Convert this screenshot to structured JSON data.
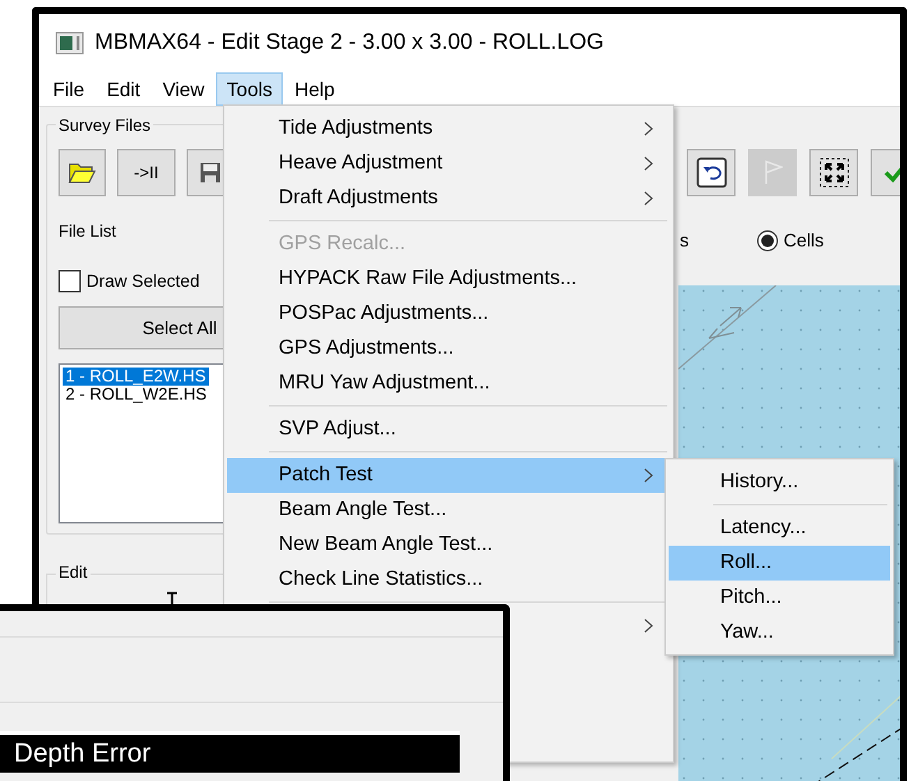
{
  "window": {
    "title": "MBMAX64 - Edit Stage 2 - 3.00 x 3.00 - ROLL.LOG"
  },
  "menu_bar": [
    {
      "label": "File",
      "selected": false
    },
    {
      "label": "Edit",
      "selected": false
    },
    {
      "label": "View",
      "selected": false
    },
    {
      "label": "Tools",
      "selected": true
    },
    {
      "label": "Help",
      "selected": false
    }
  ],
  "survey_files": {
    "title": "Survey Files",
    "buttons": [
      {
        "kind": "folder"
      },
      {
        "kind": "text",
        "label": "->II"
      },
      {
        "kind": "save"
      }
    ],
    "file_list_label": "File List",
    "draw_selected": {
      "label": "Draw Selected",
      "checked": false
    },
    "select_all": "Select All",
    "files": [
      {
        "label": "1 - ROLL_E2W.HS",
        "selected": true
      },
      {
        "label": "2 - ROLL_W2E.HS",
        "selected": false
      }
    ]
  },
  "edit": {
    "title": "Edit"
  },
  "toolbar": [
    {
      "kind": "undo",
      "disabled": false
    },
    {
      "kind": "flag",
      "disabled": true
    },
    {
      "kind": "fit",
      "disabled": false
    },
    {
      "kind": "check",
      "disabled": false
    }
  ],
  "view_option": {
    "partial_label": "s",
    "radio": {
      "label": "Cells",
      "selected": true
    }
  },
  "tools_menu": {
    "items": [
      {
        "kind": "item",
        "label": "Tide Adjustments",
        "submenu": true,
        "disabled": false,
        "selected": false
      },
      {
        "kind": "item",
        "label": "Heave Adjustment",
        "submenu": true,
        "disabled": false,
        "selected": false
      },
      {
        "kind": "item",
        "label": "Draft Adjustments",
        "submenu": true,
        "disabled": false,
        "selected": false
      },
      {
        "kind": "separator"
      },
      {
        "kind": "item",
        "label": "GPS Recalc...",
        "submenu": false,
        "disabled": true,
        "selected": false
      },
      {
        "kind": "item",
        "label": "HYPACK Raw File Adjustments...",
        "submenu": false,
        "disabled": false,
        "selected": false
      },
      {
        "kind": "item",
        "label": "POSPac Adjustments...",
        "submenu": false,
        "disabled": false,
        "selected": false
      },
      {
        "kind": "item",
        "label": "GPS Adjustments...",
        "submenu": false,
        "disabled": false,
        "selected": false
      },
      {
        "kind": "item",
        "label": "MRU Yaw Adjustment...",
        "submenu": false,
        "disabled": false,
        "selected": false
      },
      {
        "kind": "separator"
      },
      {
        "kind": "item",
        "label": "SVP Adjust...",
        "submenu": false,
        "disabled": false,
        "selected": false
      },
      {
        "kind": "separator"
      },
      {
        "kind": "item",
        "label": "Patch Test",
        "submenu": true,
        "disabled": false,
        "selected": true
      },
      {
        "kind": "item",
        "label": "Beam Angle Test...",
        "submenu": false,
        "disabled": false,
        "selected": false
      },
      {
        "kind": "item",
        "label": "New Beam Angle Test...",
        "submenu": false,
        "disabled": false,
        "selected": false
      },
      {
        "kind": "item",
        "label": "Check Line Statistics...",
        "submenu": false,
        "disabled": false,
        "selected": false
      },
      {
        "kind": "separator"
      },
      {
        "kind": "item",
        "submenu": true,
        "disabled": false,
        "selected": false
      }
    ]
  },
  "patch_test_submenu": {
    "items": [
      {
        "kind": "item",
        "label": "History...",
        "selected": false
      },
      {
        "kind": "separator"
      },
      {
        "kind": "item",
        "label": "Latency...",
        "selected": false
      },
      {
        "kind": "item",
        "label": "Roll...",
        "selected": true
      },
      {
        "kind": "item",
        "label": "Pitch...",
        "selected": false
      },
      {
        "kind": "item",
        "label": "Yaw...",
        "selected": false
      }
    ]
  },
  "second_window": {
    "heading": "Depth Error"
  }
}
